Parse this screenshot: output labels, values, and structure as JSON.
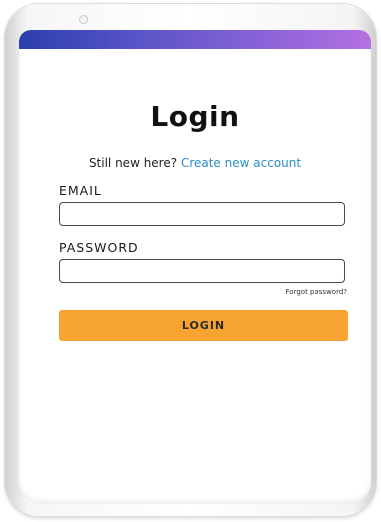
{
  "login": {
    "title": "Login",
    "signup_prompt": "Still new here?",
    "signup_link": "Create new account",
    "email_label": "EMAIL",
    "email_value": "",
    "password_label": "PASSWORD",
    "password_value": "",
    "forgot_password": "Forgot password?",
    "login_button": "LOGIN"
  },
  "colors": {
    "header_gradient_start": "#2c3fae",
    "header_gradient_end": "#b470e3",
    "link": "#2a8fc4",
    "button": "#f8a433"
  }
}
